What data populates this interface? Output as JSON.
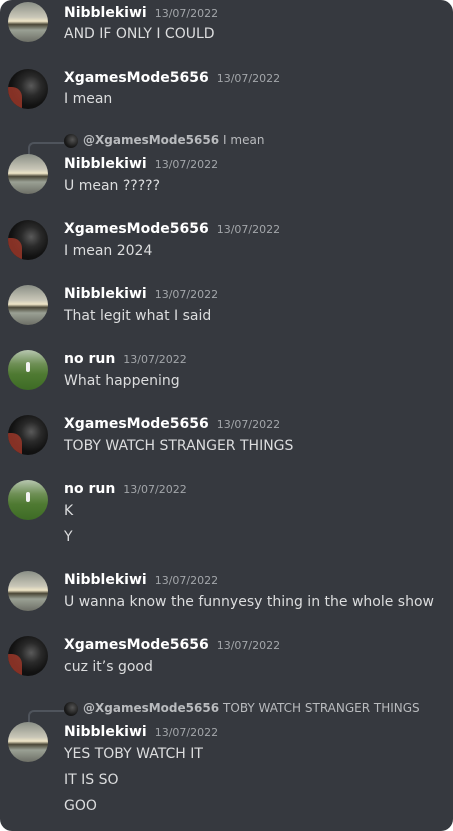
{
  "messages": [
    {
      "user": "Nibblekiwi",
      "time": "13/07/2022",
      "avatar": "sunset",
      "lines": [
        "AND IF ONLY I COULD"
      ]
    },
    {
      "user": "XgamesMode5656",
      "time": "13/07/2022",
      "avatar": "dog",
      "lines": [
        "I mean"
      ]
    },
    {
      "user": "Nibblekiwi",
      "time": "13/07/2022",
      "avatar": "sunset",
      "reply": {
        "name": "@XgamesMode5656",
        "text": "I mean"
      },
      "lines": [
        "U mean ?????"
      ]
    },
    {
      "user": "XgamesMode5656",
      "time": "13/07/2022",
      "avatar": "dog",
      "lines": [
        "I mean 2024"
      ]
    },
    {
      "user": "Nibblekiwi",
      "time": "13/07/2022",
      "avatar": "sunset",
      "lines": [
        "That legit what I said"
      ]
    },
    {
      "user": "no run",
      "time": "13/07/2022",
      "avatar": "field",
      "lines": [
        "What happening"
      ]
    },
    {
      "user": "XgamesMode5656",
      "time": "13/07/2022",
      "avatar": "dog",
      "lines": [
        "TOBY WATCH STRANGER THINGS"
      ]
    },
    {
      "user": "no run",
      "time": "13/07/2022",
      "avatar": "field",
      "lines": [
        "K",
        "Y"
      ]
    },
    {
      "user": "Nibblekiwi",
      "time": "13/07/2022",
      "avatar": "sunset",
      "lines": [
        "U wanna know the funnyesy thing in the whole show"
      ]
    },
    {
      "user": "XgamesMode5656",
      "time": "13/07/2022",
      "avatar": "dog",
      "lines": [
        "cuz it’s good"
      ]
    },
    {
      "user": "Nibblekiwi",
      "time": "13/07/2022",
      "avatar": "sunset",
      "reply": {
        "name": "@XgamesMode5656",
        "text": "TOBY WATCH STRANGER THINGS"
      },
      "lines": [
        "YES TOBY WATCH IT",
        "IT IS SO",
        "GOO"
      ]
    }
  ]
}
